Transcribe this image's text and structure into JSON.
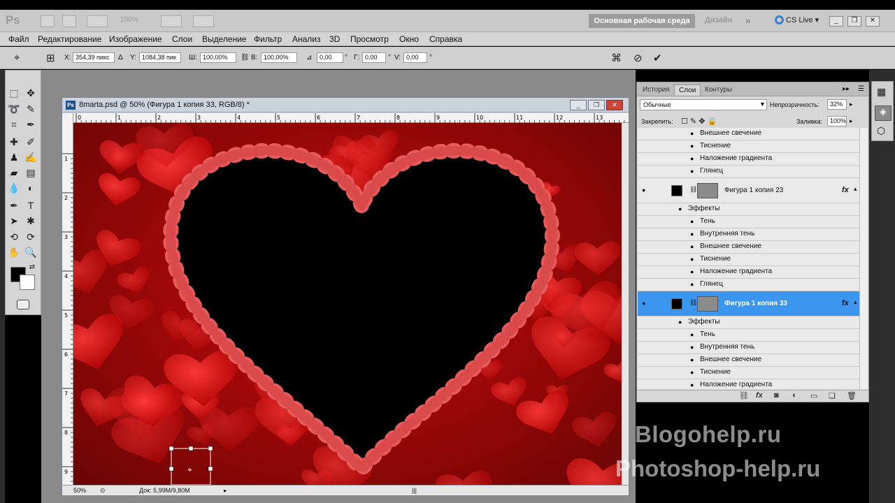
{
  "app": {
    "logo": "Ps",
    "zoom_preset": "100%",
    "workspace_button": "Основная рабочая среда",
    "design_button": "Дизайн",
    "more_button": "»",
    "cs_live": "CS Live"
  },
  "menu": [
    "Файл",
    "Редактирование",
    "Изображение",
    "Слои",
    "Выделение",
    "Фильтр",
    "Анализ",
    "3D",
    "Просмотр",
    "Окно",
    "Справка"
  ],
  "options_bar": {
    "x_label": "X:",
    "x_value": "354,39 пикс",
    "y_label": "Y:",
    "y_value": "1084,38 пик",
    "w_label": "Ш:",
    "w_value": "100,00%",
    "h_label": "В:",
    "h_value": "100,00%",
    "angle_value": "0,00",
    "skew_h_label": "Г:",
    "skew_h_value": "0,00",
    "skew_v_label": "V:",
    "skew_v_value": "0,00",
    "degree_symbol": "°"
  },
  "document": {
    "title": "8marta.psd @ 50% (Фигура 1 копия 33, RGB/8) *",
    "ruler_top": [
      "0",
      "1",
      "2",
      "3",
      "4",
      "5",
      "6",
      "7",
      "8",
      "9",
      "10",
      "11",
      "12",
      "13"
    ],
    "ruler_left": [
      "1",
      "2",
      "3",
      "4",
      "5",
      "6",
      "7",
      "8",
      "9"
    ],
    "zoom": "50%",
    "doc_size": "Док: 5,99M/9,80M"
  },
  "layers_panel": {
    "tabs": [
      "История",
      "Слои",
      "Контуры"
    ],
    "active_tab": "Слои",
    "blend_mode": "Обычные",
    "opacity_label": "Непрозрачность:",
    "opacity_value": "32%",
    "lock_label": "Закрепить:",
    "fill_label": "Заливка:",
    "fill_value": "100%",
    "effects_label": "Эффекты",
    "effects": [
      "Тень",
      "Внутренняя тень",
      "Внешнее свечение",
      "Тиснение",
      "Наложение градиента",
      "Глянец"
    ],
    "layer_23": "Фигура 1 копия 23",
    "layer_33": "Фигура 1 копия 33",
    "fx_label": "fx"
  },
  "watermarks": [
    "Blogohelp.ru",
    "Photoshop-help.ru"
  ]
}
